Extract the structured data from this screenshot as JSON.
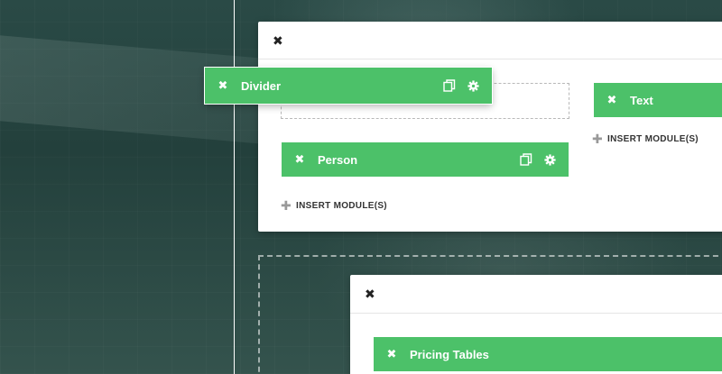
{
  "modules": {
    "divider": {
      "label": "Divider"
    },
    "person": {
      "label": "Person"
    },
    "text": {
      "label": "Text"
    },
    "pricing_tables": {
      "label": "Pricing Tables"
    }
  },
  "actions": {
    "close_glyph": "✖",
    "insert_label": "INSERT MODULE(S)",
    "plus_glyph": "✚"
  },
  "icons": {
    "close": "close-icon",
    "copy": "copy-icon",
    "settings": "gear-icon",
    "add": "plus-icon"
  },
  "colors": {
    "module_green": "#4cc169",
    "panel_white": "#ffffff",
    "background": "#24433f"
  }
}
